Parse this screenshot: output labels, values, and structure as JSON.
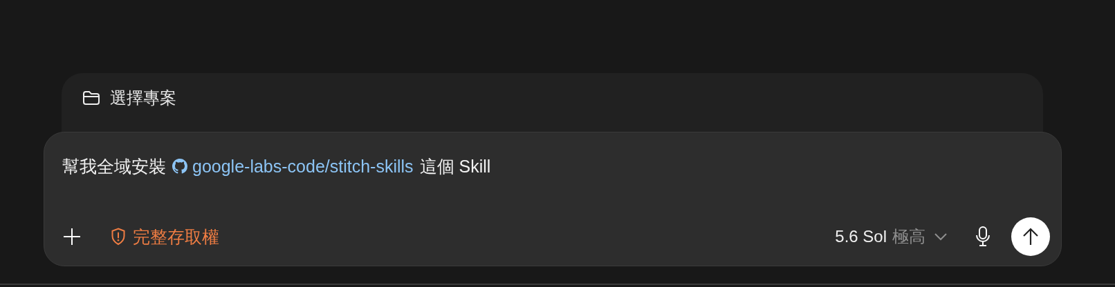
{
  "project": {
    "label": "選擇專案"
  },
  "composer": {
    "message": [
      {
        "kind": "text",
        "text": "幫我全域安裝"
      },
      {
        "kind": "repo",
        "text": "google-labs-code/stitch-skills"
      },
      {
        "kind": "text",
        "text": "這個 Skill"
      }
    ],
    "permission": {
      "label": "完整存取權"
    },
    "model": {
      "name": "5.6 Sol",
      "effort": "極高"
    }
  }
}
